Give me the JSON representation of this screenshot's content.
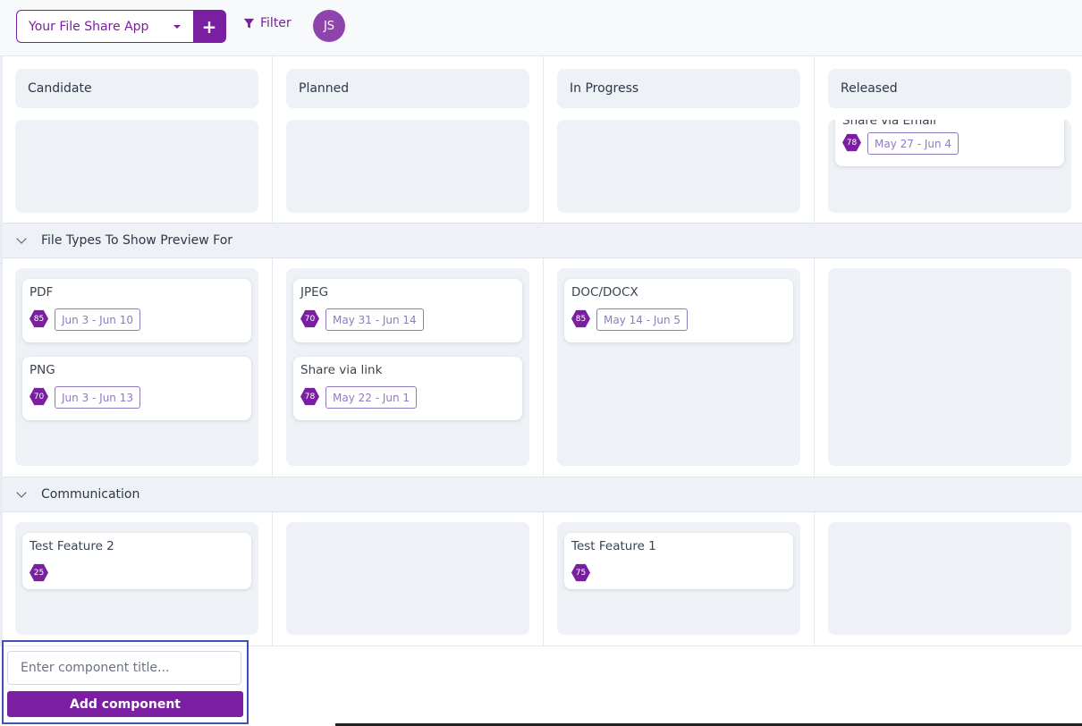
{
  "topbar": {
    "app_name": "Your File Share App",
    "filter_label": "Filter",
    "avatar_initials": "JS",
    "accent_color": "#7b1fa2"
  },
  "columns": [
    "Candidate",
    "Planned",
    "In Progress",
    "Released"
  ],
  "rows": [
    {
      "group": null,
      "cards": [
        [],
        [],
        [],
        [
          {
            "title": "Share via Email",
            "score": "78",
            "date": "May 27 - Jun 4"
          }
        ]
      ]
    },
    {
      "group": "File Types To Show Preview For",
      "cards": [
        [
          {
            "title": "PDF",
            "score": "85",
            "date": "Jun 3 - Jun 10"
          },
          {
            "title": "PNG",
            "score": "70",
            "date": "Jun 3 - Jun 13"
          }
        ],
        [
          {
            "title": "JPEG",
            "score": "70",
            "date": "May 31 - Jun 14"
          },
          {
            "title": "Share via link",
            "score": "78",
            "date": "May 22 - Jun 1"
          }
        ],
        [
          {
            "title": "DOC/DOCX",
            "score": "85",
            "date": "May 14 - Jun 5"
          }
        ],
        []
      ]
    },
    {
      "group": "Communication",
      "cards": [
        [
          {
            "title": "Test Feature 2",
            "score": "25",
            "date": null
          }
        ],
        [],
        [
          {
            "title": "Test Feature 1",
            "score": "75",
            "date": null
          }
        ],
        []
      ]
    }
  ],
  "add_component": {
    "placeholder": "Enter component title...",
    "button_label": "Add component"
  }
}
